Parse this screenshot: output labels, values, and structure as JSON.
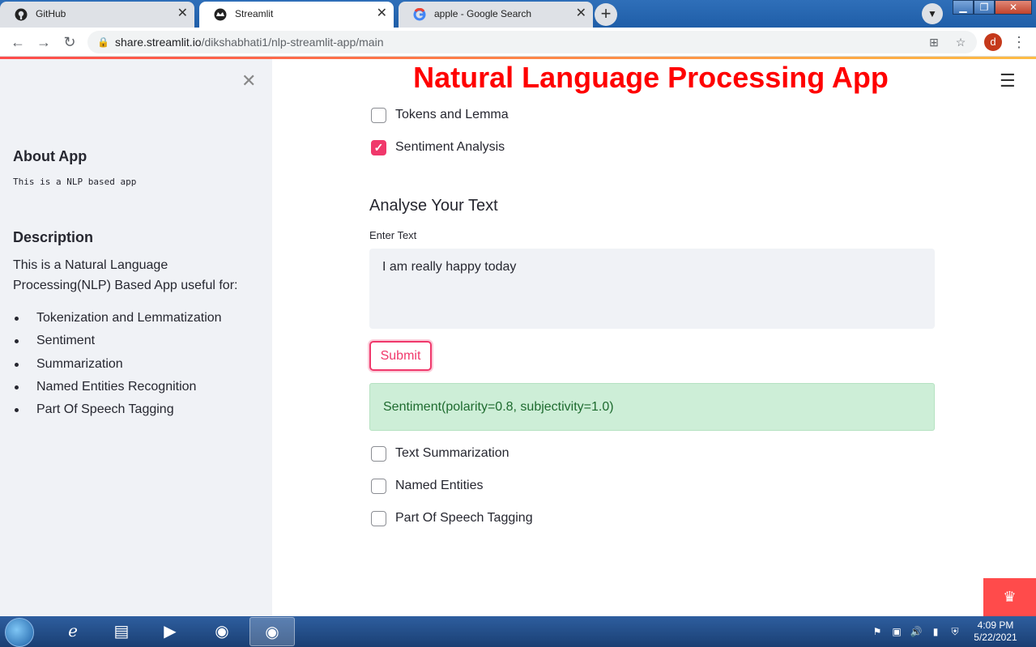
{
  "browser": {
    "tabs": [
      {
        "title": "GitHub",
        "icon": "github-icon"
      },
      {
        "title": "Streamlit",
        "icon": "streamlit-icon"
      },
      {
        "title": "apple - Google Search",
        "icon": "google-icon"
      }
    ],
    "url_host": "share.streamlit.io",
    "url_path": "/dikshabhati1/nlp-streamlit-app/main",
    "profile_initial": "d"
  },
  "sidebar": {
    "about_heading": "About App",
    "about_text": "This is a NLP based app",
    "description_heading": "Description",
    "description_text": "This is a Natural Language Processing(NLP) Based App useful for:",
    "items": [
      {
        "label": "Tokenization and Lemmatization"
      },
      {
        "label": "Sentiment"
      },
      {
        "label": "Summarization"
      },
      {
        "label": "Named Entities Recognition"
      },
      {
        "label": "Part Of Speech Tagging"
      }
    ]
  },
  "main": {
    "title": "Natural Language Processing App",
    "checkboxes_top": [
      {
        "label": "Tokens and Lemma",
        "checked": false
      },
      {
        "label": "Sentiment Analysis",
        "checked": true
      }
    ],
    "subheader": "Analyse Your Text",
    "input_label": "Enter Text",
    "input_value": "I am really happy today",
    "submit_label": "Submit",
    "result": "Sentiment(polarity=0.8, subjectivity=1.0)",
    "checkboxes_bottom": [
      {
        "label": "Text Summarization",
        "checked": false
      },
      {
        "label": "Named Entities",
        "checked": false
      },
      {
        "label": "Part Of Speech Tagging",
        "checked": false
      }
    ]
  },
  "taskbar": {
    "time": "4:09 PM",
    "date": "5/22/2021"
  },
  "colors": {
    "title": "#ff0000",
    "accent": "#f0386b",
    "success_bg": "#cdeed7",
    "sidebar_bg": "#f0f2f6"
  }
}
